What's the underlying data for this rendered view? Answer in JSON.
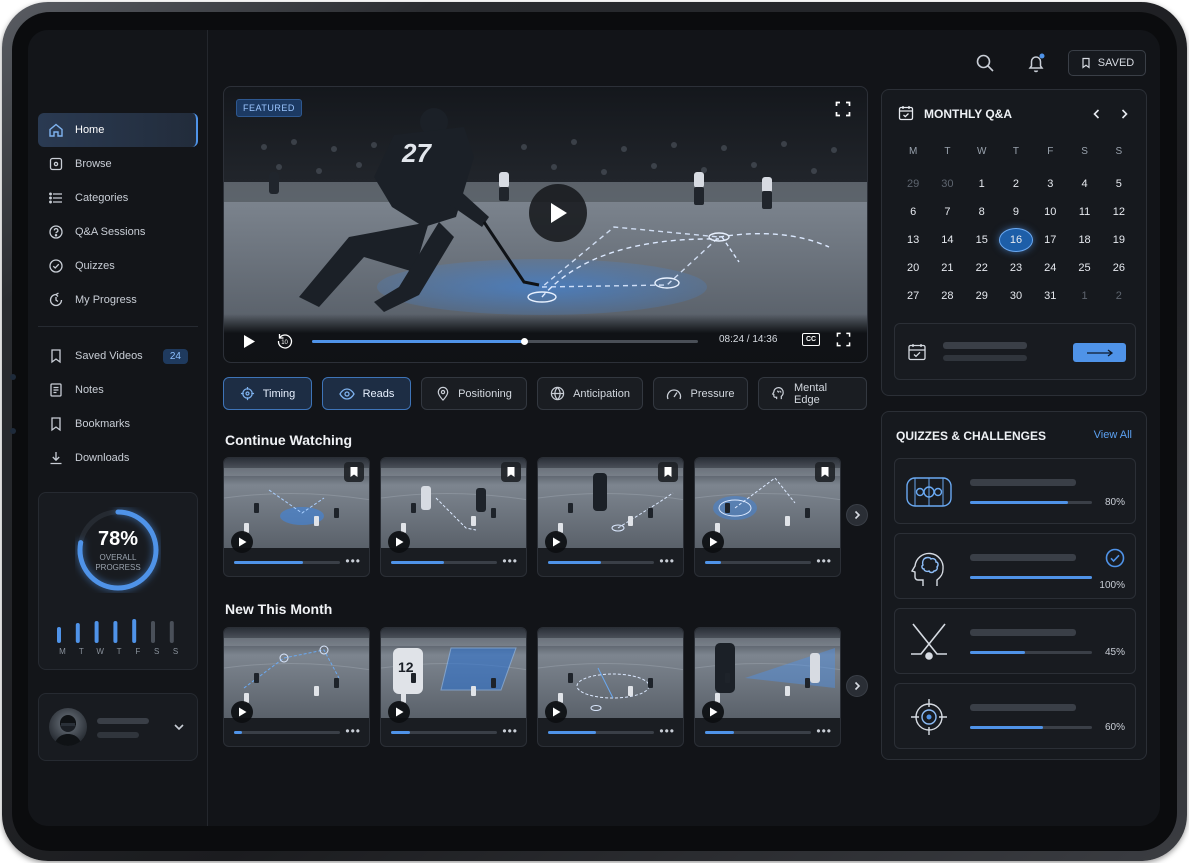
{
  "nav": {
    "items": [
      {
        "label": "Home",
        "icon": "home-icon"
      },
      {
        "label": "Browse",
        "icon": "browse-icon"
      },
      {
        "label": "Categories",
        "icon": "list-icon"
      },
      {
        "label": "Q&A Sessions",
        "icon": "qa-icon"
      },
      {
        "label": "Quizzes",
        "icon": "check-circle-icon"
      },
      {
        "label": "My Progress",
        "icon": "progress-icon"
      }
    ],
    "library": [
      {
        "label": "Saved Videos",
        "icon": "bookmark-icon",
        "count": "24"
      },
      {
        "label": "Notes",
        "icon": "notes-icon"
      },
      {
        "label": "Bookmarks",
        "icon": "bookmark-icon"
      },
      {
        "label": "Downloads",
        "icon": "download-icon"
      }
    ]
  },
  "progress": {
    "value": "78%",
    "percent": 78,
    "label_line1": "OVERALL",
    "label_line2": "PROGRESS",
    "days": [
      "M",
      "T",
      "W",
      "T",
      "F",
      "S",
      "S"
    ],
    "active_days": 5
  },
  "header": {
    "saved_label": "SAVED"
  },
  "player": {
    "badge": "FEATURED",
    "jersey": "27",
    "time": "08:24 / 14:36",
    "progress": 0.55,
    "cc_label": "CC"
  },
  "chips": [
    {
      "label": "Timing",
      "icon": "target-icon",
      "active": true
    },
    {
      "label": "Reads",
      "icon": "eye-icon",
      "active": true
    },
    {
      "label": "Positioning",
      "icon": "pin-icon",
      "active": false
    },
    {
      "label": "Anticipation",
      "icon": "globe-icon",
      "active": false
    },
    {
      "label": "Pressure",
      "icon": "gauge-icon",
      "active": false
    },
    {
      "label": "Mental Edge",
      "icon": "brain-icon",
      "active": false
    }
  ],
  "continue_watching": {
    "title": "Continue Watching",
    "cards": [
      {
        "progress": 0.65
      },
      {
        "progress": 0.5
      },
      {
        "progress": 0.5
      },
      {
        "progress": 0.15
      }
    ]
  },
  "new_this_month": {
    "title": "New This Month",
    "cards": [
      {
        "progress": 0.08,
        "jersey": ""
      },
      {
        "progress": 0.18,
        "jersey": "12"
      },
      {
        "progress": 0.45,
        "jersey": ""
      },
      {
        "progress": 0.27,
        "jersey": ""
      }
    ]
  },
  "calendar": {
    "title": "MONTHLY Q&A",
    "weekdays": [
      "M",
      "T",
      "W",
      "T",
      "F",
      "S",
      "S"
    ],
    "weeks": [
      [
        "29",
        "30",
        "1",
        "2",
        "3",
        "4",
        "5"
      ],
      [
        "6",
        "7",
        "8",
        "9",
        "10",
        "11",
        "12"
      ],
      [
        "13",
        "14",
        "15",
        "16",
        "17",
        "18",
        "19"
      ],
      [
        "20",
        "21",
        "22",
        "23",
        "24",
        "25",
        "26"
      ],
      [
        "27",
        "28",
        "29",
        "30",
        "31",
        "1",
        "2"
      ]
    ],
    "today": "16"
  },
  "quizzes": {
    "title": "QUIZZES & CHALLENGES",
    "view_all": "View All",
    "items": [
      {
        "icon": "rink-icon",
        "percent": "80%",
        "value": 0.8,
        "completed": false
      },
      {
        "icon": "brain-head-icon",
        "percent": "100%",
        "value": 1.0,
        "completed": true
      },
      {
        "icon": "sticks-icon",
        "percent": "45%",
        "value": 0.45,
        "completed": false
      },
      {
        "icon": "crosshair-icon",
        "percent": "60%",
        "value": 0.6,
        "completed": false
      }
    ]
  },
  "colors": {
    "accent": "#4f93e8",
    "background": "#121418",
    "panel": "#16191e"
  }
}
